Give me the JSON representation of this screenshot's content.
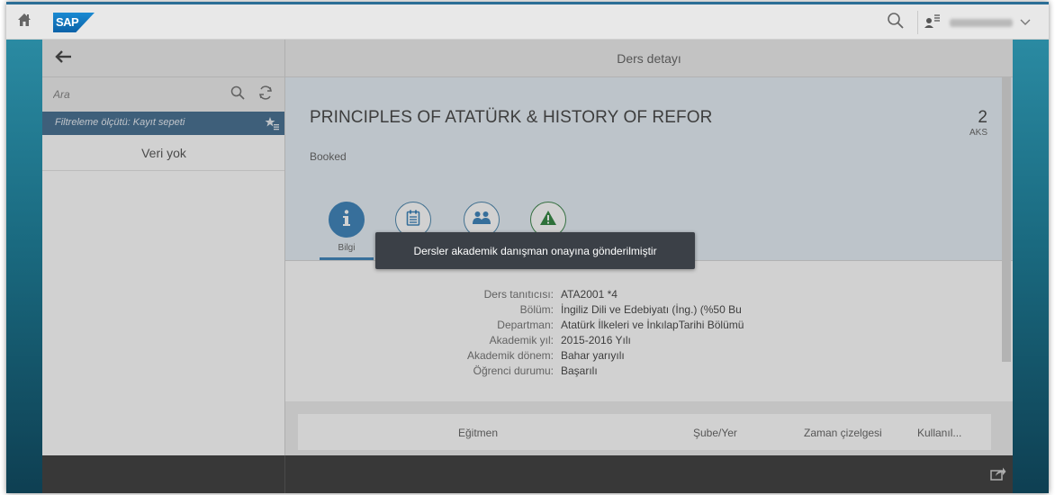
{
  "shell": {
    "logo_text": "SAP",
    "accent_color": "#2b6e96",
    "icons": [
      "home-icon",
      "search-icon",
      "user-icon",
      "chevron-down-icon"
    ]
  },
  "master": {
    "search_placeholder": "Ara",
    "filter_text": "Filtreleme ölçütü: Kayıt sepeti",
    "no_data_text": "Veri yok"
  },
  "detail": {
    "header_title": "Ders detayı",
    "object": {
      "title": "PRINCIPLES OF ATATÜRK & HISTORY OF REFOR",
      "number": "2",
      "unit": "AKS",
      "status": "Booked"
    },
    "tabs": [
      {
        "label": "Bilgi",
        "icon": "info-icon",
        "selected": true
      },
      {
        "label": "",
        "icon": "notes-icon",
        "selected": false
      },
      {
        "label": "",
        "icon": "people-icon",
        "selected": false
      },
      {
        "label": "",
        "icon": "warning-icon",
        "selected": false
      }
    ],
    "fields": [
      {
        "label": "Ders tanıtıcısı:",
        "value": "ATA2001 *4"
      },
      {
        "label": "Bölüm:",
        "value": "İngiliz Dili ve Edebiyatı (İng.) (%50 Bu"
      },
      {
        "label": "Departman:",
        "value": "Atatürk İlkeleri ve İnkılapTarihi Bölümü"
      },
      {
        "label": "Akademik yıl:",
        "value": "2015-2016 Yılı"
      },
      {
        "label": "Akademik dönem:",
        "value": "Bahar yarıyılı"
      },
      {
        "label": "Öğrenci durumu:",
        "value": "Başarılı"
      }
    ],
    "table_columns": [
      "Eğitmen",
      "Şube/Yer",
      "Zaman çizelgesi",
      "Kullanıl..."
    ]
  },
  "toast": {
    "message": "Dersler akademik danışman onayına gönderilmiştir"
  },
  "colors": {
    "filter_bar": "#346187",
    "tab_active": "#2a78b4",
    "object_header_bg": "#e4eef5",
    "footer_bg": "#2b2b2b",
    "toast_bg": "#3b4047"
  }
}
